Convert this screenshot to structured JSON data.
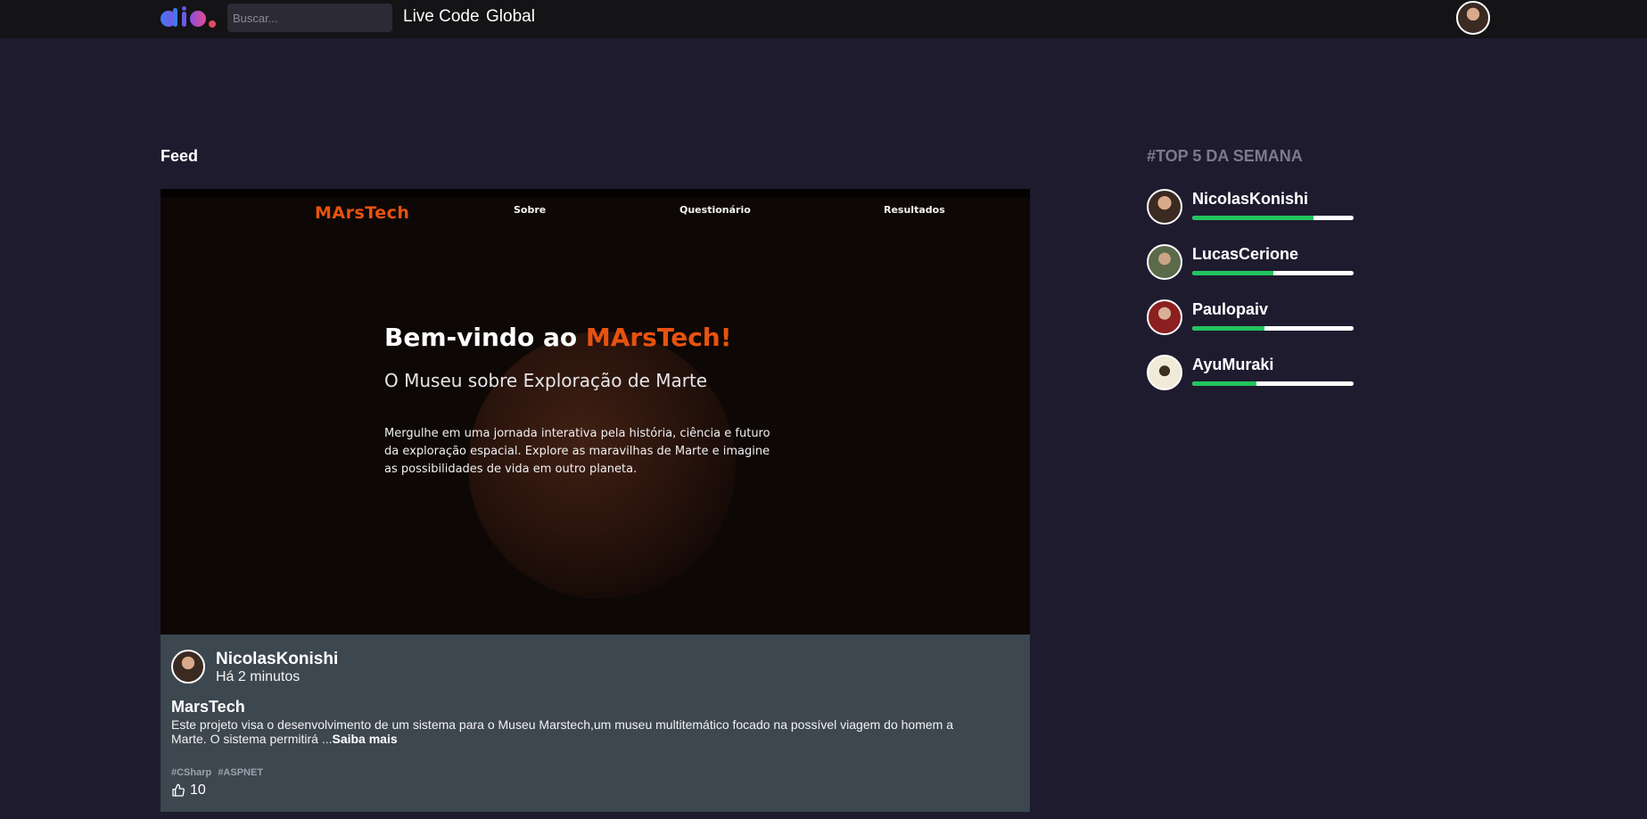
{
  "header": {
    "search_placeholder": "Buscar...",
    "nav": [
      {
        "label": "Live Code"
      },
      {
        "label": "Global"
      }
    ]
  },
  "feed": {
    "title": "Feed",
    "post": {
      "preview": {
        "logo": "MArsTech",
        "nav": [
          "Sobre",
          "Questionário",
          "Resultados"
        ],
        "hero_title_prefix": "Bem-vindo ao ",
        "hero_title_accent": "MArsTech!",
        "hero_subtitle": "O Museu sobre Exploração de Marte",
        "hero_description": "Mergulhe em uma jornada interativa pela história, ciência e futuro da exploração espacial. Explore as maravilhas de Marte e imagine as possibilidades de vida em outro planeta."
      },
      "author": "NicolasKonishi",
      "time": "Há 2 minutos",
      "title": "MarsTech",
      "description": "Este projeto visa o desenvolvimento de um sistema para o Museu Marstech,um museu multitemático focado na possível viagem do homem a Marte. O sistema permitirá ...",
      "read_more": "Saiba mais",
      "tags": [
        "#CSharp",
        "#ASPNET"
      ],
      "likes": "10",
      "like_icon": "thumbs-up-icon"
    }
  },
  "ranking": {
    "title": "#TOP 5 DA SEMANA",
    "users": [
      {
        "name": "NicolasKonishi",
        "progress": 0.75
      },
      {
        "name": "LucasCerione",
        "progress": 0.5
      },
      {
        "name": "Paulopaiv",
        "progress": 0.45
      },
      {
        "name": "AyuMuraki",
        "progress": 0.4
      }
    ]
  },
  "colors": {
    "background": "#1f1b2f",
    "topbar": "#141316",
    "card": "#3d4750",
    "accent_orange": "#e8520f",
    "progress_green": "#22c55e",
    "ranking_title": "#7d7a89"
  }
}
